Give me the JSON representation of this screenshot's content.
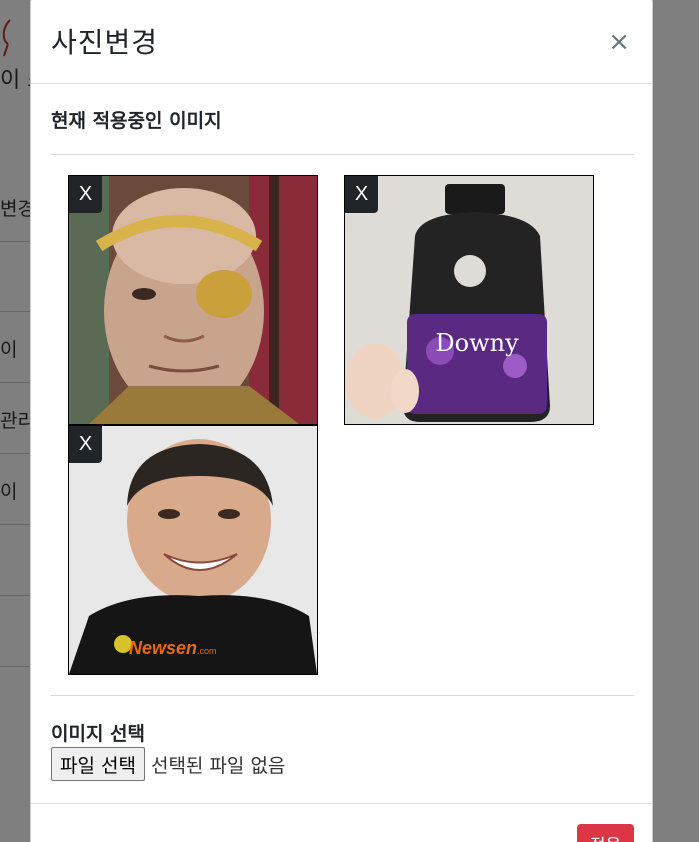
{
  "background": {
    "brand_fragment": "이 스",
    "menu_fragments": [
      "변경",
      "",
      "이",
      "관리",
      "이",
      "",
      ""
    ]
  },
  "modal": {
    "title": "사진변경",
    "close_symbol": "×",
    "current_images_heading": "현재 적용중인 이미지",
    "images": [
      {
        "name": "eyepatch-man-photo",
        "remove_label": "X"
      },
      {
        "name": "downy-bottle-photo",
        "remove_label": "X"
      },
      {
        "name": "smiling-man-photo",
        "remove_label": "X",
        "caption": "Newsen.com"
      }
    ],
    "image_select_heading": "이미지 선택",
    "file_button_label": "파일 선택",
    "file_status": "선택된 파일 없음",
    "apply_label": "적용"
  },
  "colors": {
    "backdrop": "#808080",
    "apply_button": "#dc3545",
    "remove_button": "#212529"
  }
}
